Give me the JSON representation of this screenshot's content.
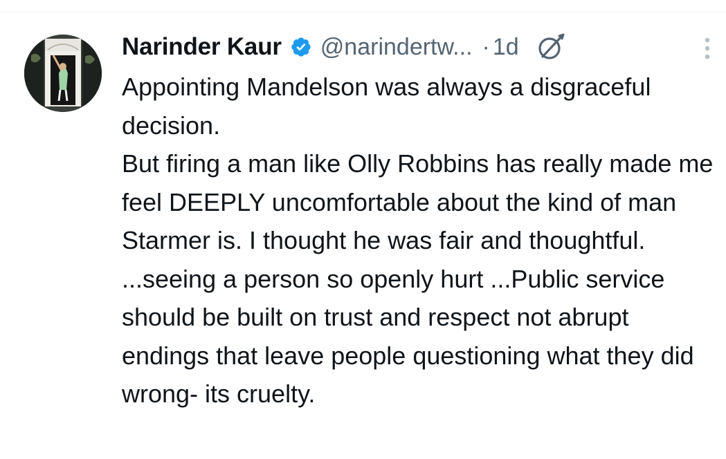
{
  "tweet": {
    "author_name": "Narinder Kaur",
    "handle": "@narindertw...",
    "separator": "·",
    "time": "1d",
    "verified_icon": "verified-badge-icon",
    "grok_icon": "grok-icon",
    "more_icon": "more-options-icon",
    "accent_color": "#1d9bf0",
    "paragraphs": [
      "Appointing Mandelson was always a disgraceful decision.",
      "But firing a man like Olly Robbins has really made me feel DEEPLY uncomfortable about the kind of man Starmer is. I thought he was fair and thoughtful.",
      "...seeing a person so openly hurt ...Public service should be built on trust and respect not abrupt endings that leave people questioning what they did wrong- its cruelty."
    ]
  }
}
